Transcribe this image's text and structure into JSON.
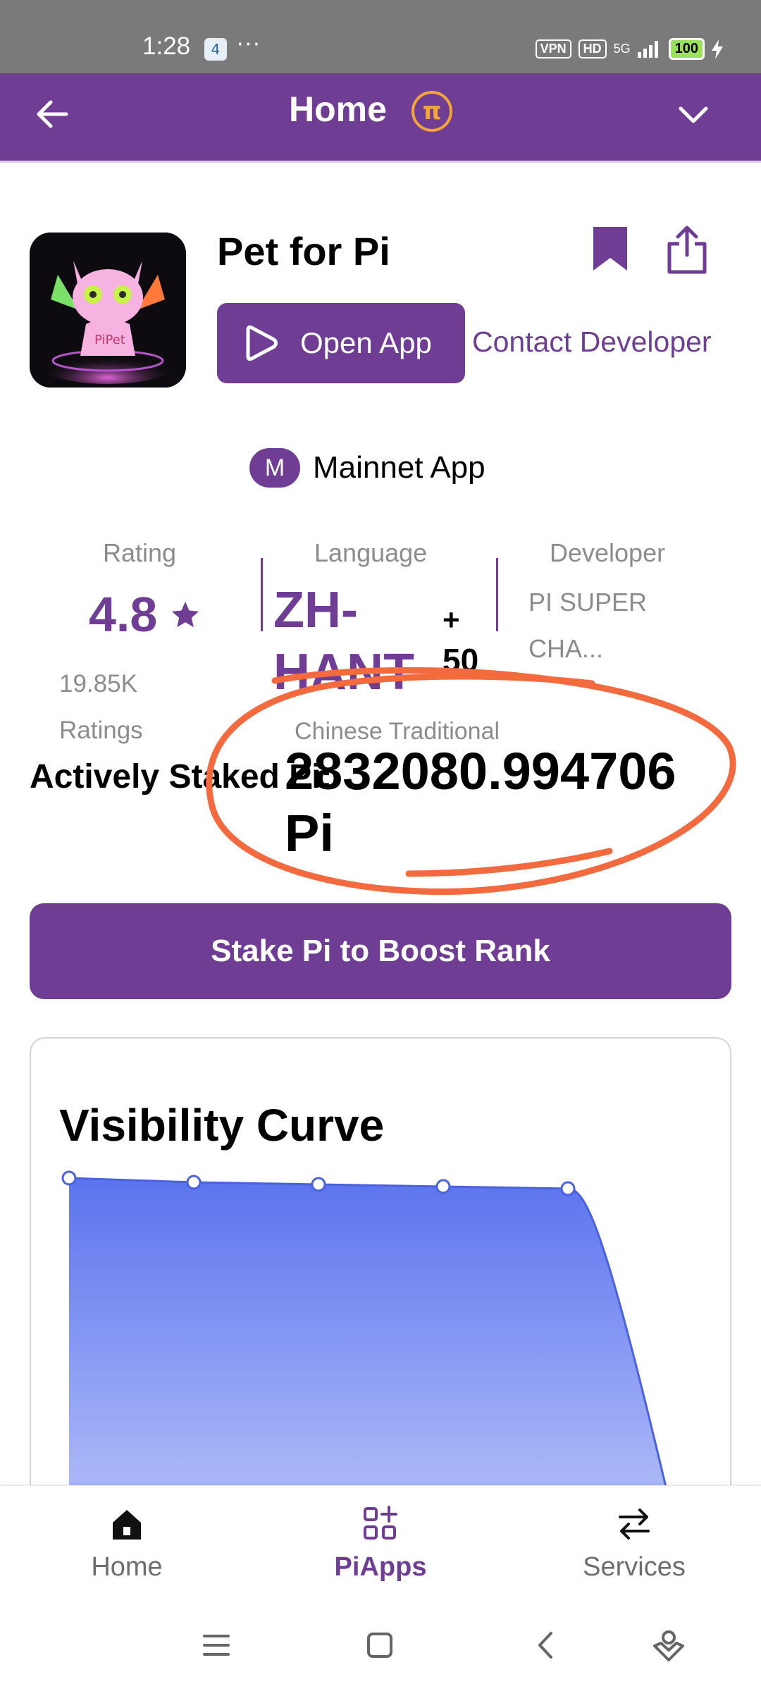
{
  "status_bar": {
    "time": "1:28",
    "notification_badge": "4",
    "more": "···",
    "vpn": "VPN",
    "hd": "HD",
    "network": "5G",
    "battery": "100"
  },
  "header": {
    "title": "Home",
    "logo_glyph": "π"
  },
  "app": {
    "name": "Pet for Pi",
    "open_button": "Open App",
    "contact_link": "Contact Developer",
    "mainnet_badge": "M",
    "mainnet_label": "Mainnet App"
  },
  "stats": {
    "rating_label": "Rating",
    "rating_value": "4.8",
    "ratings_count": "19.85K Ratings",
    "language_label": "Language",
    "language_value": "ZH-HANT",
    "language_plus": "+",
    "language_more": "50",
    "language_sub": "Chinese Traditional",
    "developer_label": "Developer",
    "developer_value": "PI SUPER CHA..."
  },
  "staking": {
    "label": "Actively Staked Pi:",
    "value": "2832080.994706",
    "unit": "Pi",
    "button": "Stake Pi to Boost Rank"
  },
  "chart_data": {
    "type": "area",
    "title": "Visibility Curve",
    "xlabel": "",
    "ylabel": "",
    "x": [
      0,
      1,
      2,
      3,
      4,
      5
    ],
    "values": [
      1.0,
      0.99,
      0.985,
      0.98,
      0.975,
      0.0
    ],
    "marked_points": 5,
    "ylim": [
      0,
      1
    ],
    "grid": false,
    "colors": {
      "line": "#4a62dd",
      "fill_top": "#5b73ee",
      "fill_bottom": "#c9d2fb"
    }
  },
  "bottom_nav": {
    "items": [
      {
        "label": "Home",
        "icon": "home-icon"
      },
      {
        "label": "PiApps",
        "icon": "apps-icon"
      },
      {
        "label": "Services",
        "icon": "swap-icon"
      }
    ]
  },
  "colors": {
    "brand": "#6f3e94",
    "pi_gold": "#f3a53c",
    "annotation": "#f26a3d"
  }
}
